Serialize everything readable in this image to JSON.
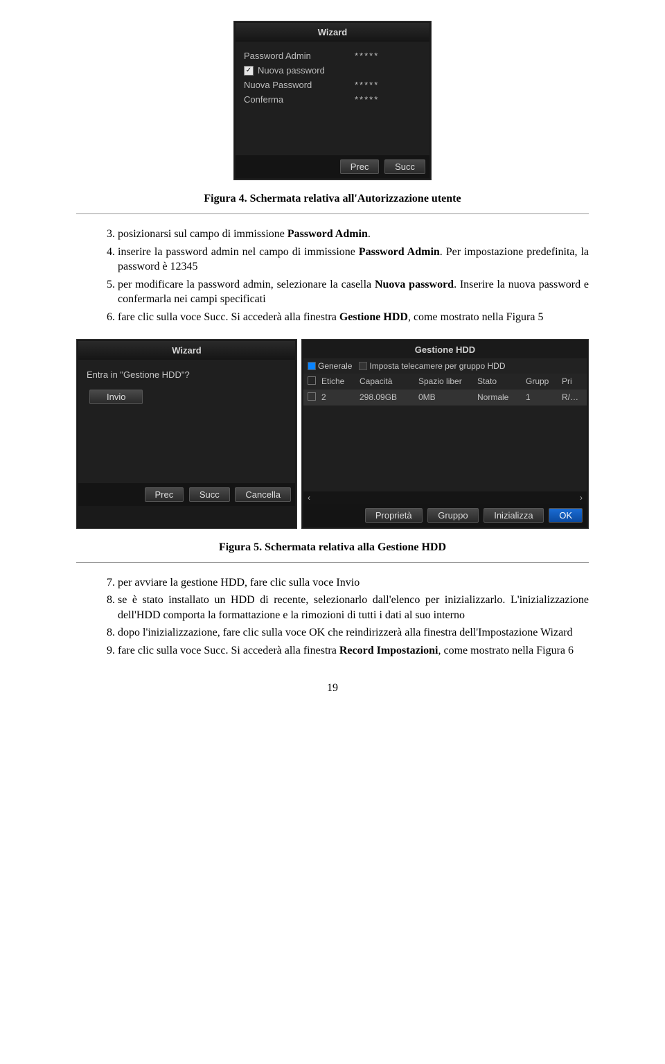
{
  "wizard1": {
    "title": "Wizard",
    "rows": [
      {
        "label": "Password Admin",
        "value": "*****",
        "checkbox": false
      },
      {
        "label": "Nuova password",
        "value": "",
        "checkbox": true,
        "checked": true
      },
      {
        "label": "Nuova Password",
        "value": "*****",
        "checkbox": false
      },
      {
        "label": "Conferma",
        "value": "*****",
        "checkbox": false
      }
    ],
    "btn_prev": "Prec",
    "btn_next": "Succ"
  },
  "caption1": "Figura 4. Schermata relativa all'Autorizzazione utente",
  "steps_a": {
    "start": 3,
    "items": [
      {
        "text_pre": "posizionarsi sul campo di immissione ",
        "bold": "Password Admin",
        "text_post": "."
      },
      {
        "text_pre": "inserire la password admin nel campo di immissione ",
        "bold": "Password Admin",
        "text_post": ". Per impostazione predefinita, la password è 12345"
      },
      {
        "text_pre": "per modificare la password admin, selezionare la casella ",
        "bold": "Nuova password",
        "text_post": ". Inserire la nuova password e confermarla nei campi specificati"
      },
      {
        "text_pre": "fare clic sulla voce Succ. Si accederà alla finestra ",
        "bold": "Gestione HDD",
        "text_post": ", come mostrato nella Figura 5"
      }
    ]
  },
  "wizard2a": {
    "title": "Wizard",
    "question": "Entra in \"Gestione HDD\"?",
    "btn_invio": "Invio",
    "btn_prev": "Prec",
    "btn_next": "Succ",
    "btn_cancel": "Cancella"
  },
  "hdd_panel": {
    "title": "Gestione HDD",
    "tab1": "Generale",
    "tab2": "Imposta telecamere per gruppo HDD",
    "cols": [
      "",
      "Etiche",
      "Capacità",
      "Spazio liber",
      "Stato",
      "Grupp",
      "Pri"
    ],
    "row": [
      "",
      "2",
      "298.09GB",
      "0MB",
      "Normale",
      "1",
      "R/…"
    ],
    "scroll_left": "‹",
    "scroll_right": "›",
    "btn_prop": "Proprietà",
    "btn_group": "Gruppo",
    "btn_init": "Inizializza",
    "btn_ok": "OK"
  },
  "caption2": "Figura 5. Schermata relativa alla Gestione HDD",
  "steps_b": {
    "start": 7,
    "items": [
      {
        "text": "per avviare la gestione HDD, fare clic sulla voce Invio"
      },
      {
        "text": "se è stato installato un HDD di recente, selezionarlo dall'elenco per inizializzarlo. L'inizializzazione dell'HDD comporta la formattazione e la rimozioni di tutti i dati al suo interno"
      },
      {
        "text": "dopo l'inizializzazione, fare clic sulla voce OK che reindirizzerà alla finestra dell'Impostazione Wizard"
      },
      {
        "text_pre": "fare clic sulla voce Succ. Si accederà alla finestra ",
        "bold": "Record Impostazioni",
        "text_post": ", come mostrato nella Figura 6"
      }
    ]
  },
  "page_number": "19"
}
